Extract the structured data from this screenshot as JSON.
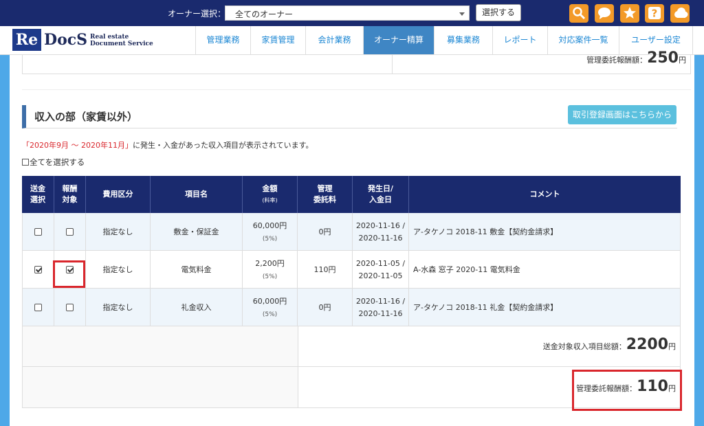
{
  "topbar": {
    "owner_label": "オーナー選択：",
    "owner_select_value": "全てのオーナー",
    "select_button": "選択する",
    "icons": [
      "search-icon",
      "chat-icon",
      "star-icon",
      "help-icon",
      "cloud-icon"
    ],
    "icon_color": "#f39a28"
  },
  "logo": {
    "re": "Re",
    "docs": "DocS",
    "sub1": "Real estate",
    "sub2": "Document Service"
  },
  "nav": {
    "items": [
      "管理業務",
      "家賃管理",
      "会計業務",
      "オーナー精算",
      "募集業務",
      "レポート",
      "対応案件一覧",
      "ユーザー設定"
    ],
    "active": "オーナー精算"
  },
  "previous": {
    "fee_label": "管理委託報酬額：",
    "fee_value": "250",
    "fee_unit": "円"
  },
  "section": {
    "title": "収入の部（家賃以外）",
    "tx_button": "取引登録画面はこちらから",
    "period_highlight": "「2020年9月 ～ 2020年11月」",
    "period_text": "に発生・入金があった収入項目が表示されています。",
    "select_all": "全てを選択する"
  },
  "table": {
    "headers": {
      "send": [
        "送金",
        "選択"
      ],
      "fee_target": [
        "報酬",
        "対象"
      ],
      "category": "費用区分",
      "item": "項目名",
      "amount": "金額",
      "amount_sub": "(料率)",
      "mgmt_fee": [
        "管理",
        "委託料"
      ],
      "date": [
        "発生日/",
        "入金日"
      ],
      "comment": "コメント"
    },
    "rows": [
      {
        "send": false,
        "fee_target": false,
        "category": "指定なし",
        "item": "敷金・保証金",
        "amount": "60,000円",
        "rate": "(5%)",
        "fee": "0円",
        "date1": "2020-11-16 /",
        "date2": "2020-11-16",
        "comment": "ア-タケノコ 2018-11 敷金【契約金請求】"
      },
      {
        "send": true,
        "fee_target": true,
        "category": "指定なし",
        "item": "電気料金",
        "amount": "2,200円",
        "rate": "(5%)",
        "fee": "110円",
        "date1": "2020-11-05 /",
        "date2": "2020-11-05",
        "comment": "A-水森 窓子 2020-11 電気料金"
      },
      {
        "send": false,
        "fee_target": false,
        "category": "指定なし",
        "item": "礼金収入",
        "amount": "60,000円",
        "rate": "(5%)",
        "fee": "0円",
        "date1": "2020-11-16 /",
        "date2": "2020-11-16",
        "comment": "ア-タケノコ 2018-11 礼金【契約金請求】"
      }
    ]
  },
  "summary": {
    "total_label": "送金対象収入項目総額：",
    "total_value": "2200",
    "total_unit": "円",
    "fee_label": "管理委託報酬額：",
    "fee_value": "110",
    "fee_unit": "円"
  },
  "colors": {
    "header_navy": "#1a2a6e",
    "active_nav": "#3f86c4",
    "accent_red": "#d9262c",
    "button_teal": "#5bc0de"
  }
}
